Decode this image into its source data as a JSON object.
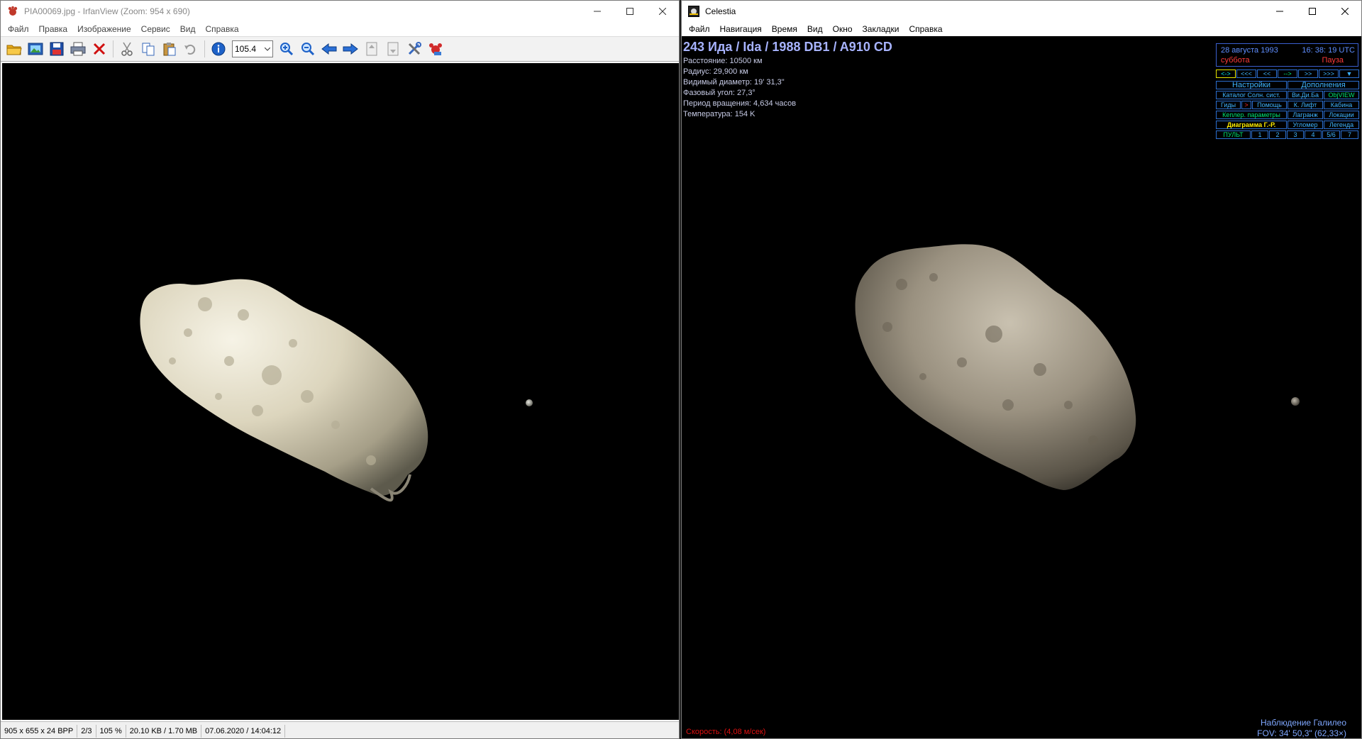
{
  "irfanview": {
    "title": "PIA00069.jpg - IrfanView (Zoom: 954 x 690)",
    "menu": [
      "Файл",
      "Правка",
      "Изображение",
      "Сервис",
      "Вид",
      "Справка"
    ],
    "toolbar": {
      "zoom_value": "105.4",
      "icons": [
        "open-folder-icon",
        "slideshow-icon",
        "save-icon",
        "print-icon",
        "delete-icon",
        "cut-icon",
        "copy-icon",
        "paste-icon",
        "undo-icon",
        "info-icon",
        "zoom-in-icon",
        "zoom-out-icon",
        "previous-icon",
        "next-icon",
        "first-page-icon",
        "last-page-icon",
        "settings-icon",
        "plugin-icon"
      ]
    },
    "status": {
      "dimensions": "905 x 655 x 24 BPP",
      "index": "2/3",
      "zoom": "105 %",
      "size": "20.10 KB / 1.70 MB",
      "datetime": "07.06.2020 / 14:04:12"
    }
  },
  "celestia": {
    "title": "Celestia",
    "menu": [
      "Файл",
      "Навигация",
      "Время",
      "Вид",
      "Окно",
      "Закладки",
      "Справка"
    ],
    "object_title": "243 Ида / Ida / 1988 DB1 / A910 CD",
    "info_lines": [
      "Расстояние: 10500 км",
      "Радиус: 29,900 км",
      "Видимый диаметр: 19' 31,3\"",
      "Фазовый угол: 27,3°",
      "Период вращения: 4,634 часов",
      "Температура: 154 K"
    ],
    "clock": {
      "date": "28 августа 1993",
      "time": "16: 38: 19  UTC",
      "weekday": "суббота",
      "status": "Пауза"
    },
    "nav_buttons": [
      "<->",
      "<<<",
      "<<",
      "-->",
      ">>",
      ">>>",
      "▼"
    ],
    "buttons": {
      "settings": "Настройки",
      "addons": "Дополнения",
      "solar_catalog": "Каталог Солн. сист.",
      "wikidb": "Ви.Ди.Ба",
      "objview": "ObjVIEW",
      "guides": "Гиды",
      "guides_extra": ">",
      "help": "Помощь",
      "space_lift": "К. Лифт",
      "cabin": "Кабина",
      "kepler": "Кеплер. параметры",
      "lagrange": "Лагранж",
      "locations": "Локации",
      "hr_diagram": "Диаграмма Г.-Р.",
      "protractor": "Угломер",
      "legend": "Легенда",
      "console": "ПУЛЬТ",
      "n1": "1",
      "n2": "2",
      "n3": "3",
      "n4": "4",
      "n56": "5/6",
      "n7": "7"
    },
    "speed": "Скорость: (4,08 м/сек)",
    "observation": "Наблюдение Галилео",
    "fov": "FOV: 34' 50,3\" (62,33×)"
  }
}
